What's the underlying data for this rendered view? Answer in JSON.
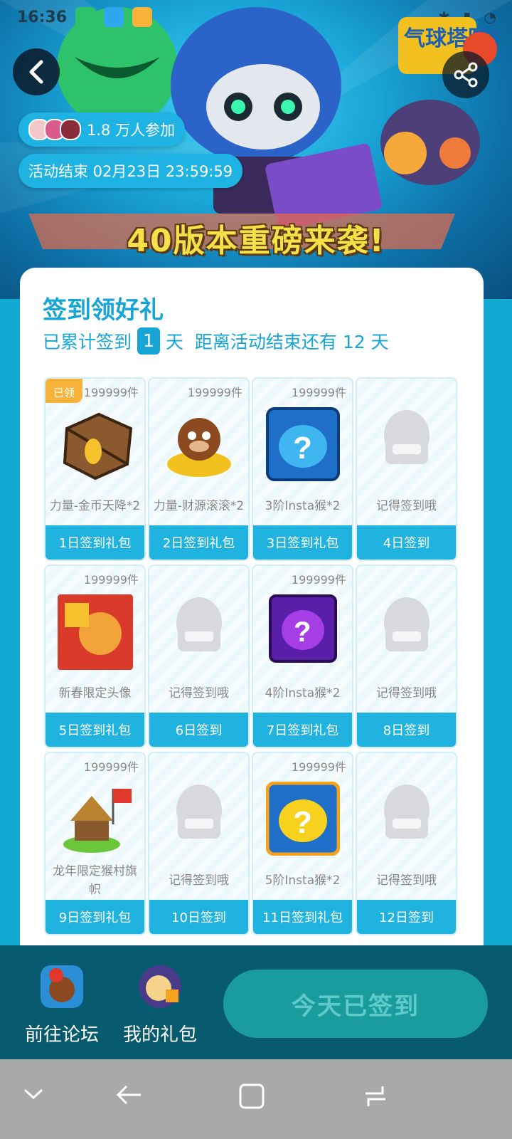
{
  "status_bar": {
    "time": "16:36"
  },
  "hero": {
    "logo_text": "气球塔防6",
    "participants": "1.8 万人参加",
    "end_time": "活动结束 02月23日 23:59:59",
    "banner_title": "40版本重磅来袭!"
  },
  "checkin": {
    "title": "签到领好礼",
    "sub_prefix": "已累计签到",
    "days_count": "1",
    "sub_suffix": "天  距离活动结束还有 12 天",
    "claimed_label": "已领",
    "cells": [
      {
        "count": "199999件",
        "name": "力量-金币天降*2",
        "day": "1日签到礼包",
        "icon": "crate-icon",
        "claimed": true
      },
      {
        "count": "199999件",
        "name": "力量-财源滚滚*2",
        "day": "2日签到礼包",
        "icon": "money-monkey-icon"
      },
      {
        "count": "199999件",
        "name": "3阶Insta猴*2",
        "day": "3日签到礼包",
        "icon": "insta-monkey-blue-icon"
      },
      {
        "count": "",
        "name": "记得签到哦",
        "day": "4日签到",
        "icon": "placeholder-icon"
      },
      {
        "count": "199999件",
        "name": "新春限定头像",
        "day": "5日签到礼包",
        "icon": "new-year-avatar-icon"
      },
      {
        "count": "",
        "name": "记得签到哦",
        "day": "6日签到",
        "icon": "placeholder-icon"
      },
      {
        "count": "199999件",
        "name": "4阶Insta猴*2",
        "day": "7日签到礼包",
        "icon": "insta-monkey-purple-icon"
      },
      {
        "count": "",
        "name": "记得签到哦",
        "day": "8日签到",
        "icon": "placeholder-icon"
      },
      {
        "count": "199999件",
        "name": "龙年限定猴村旗帜",
        "day": "9日签到礼包",
        "icon": "village-flag-icon"
      },
      {
        "count": "",
        "name": "记得签到哦",
        "day": "10日签到",
        "icon": "placeholder-icon"
      },
      {
        "count": "199999件",
        "name": "5阶Insta猴*2",
        "day": "11日签到礼包",
        "icon": "insta-monkey-yellow-icon"
      },
      {
        "count": "",
        "name": "记得签到哦",
        "day": "12日签到",
        "icon": "placeholder-icon"
      }
    ]
  },
  "bottom": {
    "forum_label": "前往论坛",
    "gifts_label": "我的礼包",
    "checkin_button": "今天已签到"
  },
  "colors": {
    "accent": "#17a5d6",
    "bar": "#085a6e",
    "tag": "#f7b23a"
  }
}
